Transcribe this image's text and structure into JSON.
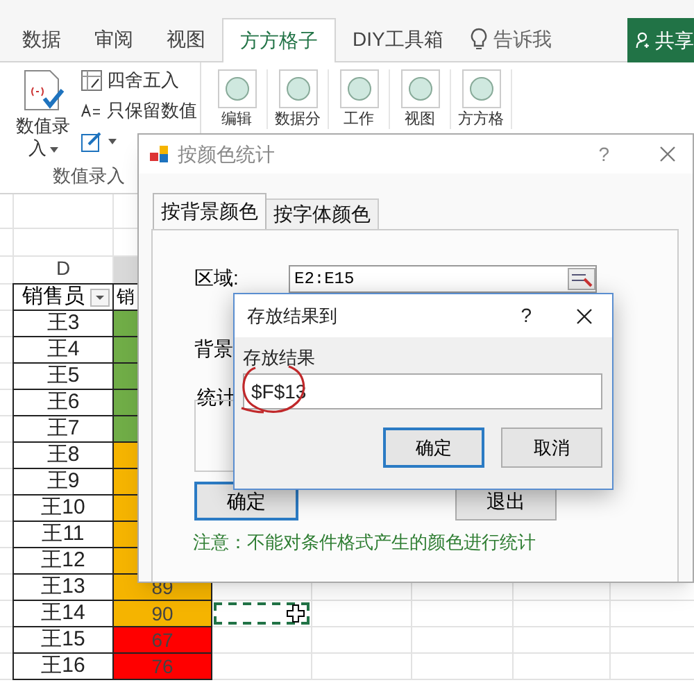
{
  "ribbon_tabs": [
    {
      "label": "数据",
      "selected": false
    },
    {
      "label": "审阅",
      "selected": false
    },
    {
      "label": "视图",
      "selected": false
    },
    {
      "label": "方方格子",
      "selected": true
    },
    {
      "label": "DIY工具箱",
      "selected": false
    }
  ],
  "tell_me": "告诉我",
  "share_button": "共享",
  "ribbon": {
    "large_button": "数值录入",
    "small_buttons": [
      "四舍五入",
      "只保留数值"
    ],
    "group_label": "数值录入",
    "tool_buttons": [
      "编辑",
      "数据分",
      "工作",
      "视图",
      "方方格"
    ]
  },
  "sheet": {
    "column_header": "D",
    "header_cells": [
      "销售员",
      "销"
    ],
    "rows": [
      {
        "name": "王3",
        "color": "#70ad47"
      },
      {
        "name": "王4",
        "color": "#70ad47"
      },
      {
        "name": "王5",
        "color": "#70ad47"
      },
      {
        "name": "王6",
        "color": "#70ad47"
      },
      {
        "name": "王7",
        "color": "#70ad47"
      },
      {
        "name": "王8",
        "color": "#f5b400"
      },
      {
        "name": "王9",
        "color": "#f5b400"
      },
      {
        "name": "王10",
        "color": "#f5b400"
      },
      {
        "name": "王11",
        "color": "#f5b400"
      },
      {
        "name": "王12",
        "color": "#f5b400"
      },
      {
        "name": "王13",
        "color": "#f5b400",
        "value": "89"
      },
      {
        "name": "王14",
        "color": "#f5b400",
        "value": "90"
      },
      {
        "name": "王15",
        "color": "#ff0000",
        "value": "67"
      },
      {
        "name": "王16",
        "color": "#ff0000",
        "value": "76"
      }
    ]
  },
  "dialog": {
    "title": "按颜色统计",
    "help": "?",
    "tabs": [
      {
        "label": "按背景颜色",
        "selected": true
      },
      {
        "label": "按字体颜色",
        "selected": false
      }
    ],
    "range_label": "区域:",
    "range_value": "E2:E15",
    "background_label": "背景",
    "stats_label": "统计",
    "ok_button": "确定",
    "exit_button": "退出",
    "note": "注意：不能对条件格式产生的颜色进行统计"
  },
  "sub_dialog": {
    "title": "存放结果到",
    "help": "?",
    "field_label": "存放结果",
    "field_value": "$F$13",
    "ok_button": "确定",
    "cancel_button": "取消"
  }
}
